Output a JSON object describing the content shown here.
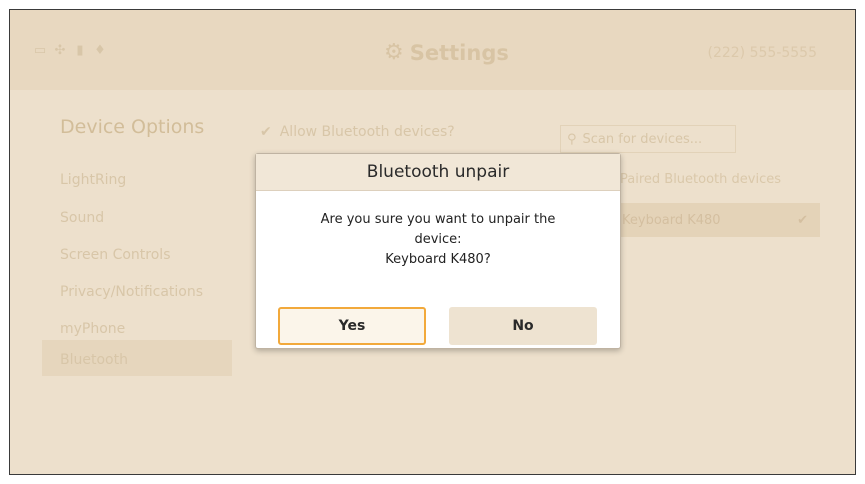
{
  "header": {
    "icons": [
      "display-icon",
      "arrows-icon",
      "camera-icon",
      "microphone-icon"
    ],
    "title": "Settings",
    "phone": "(222) 555-5555"
  },
  "sidebar": {
    "title": "Device Options",
    "items": [
      {
        "label": "LightRing"
      },
      {
        "label": "Sound"
      },
      {
        "label": "Screen Controls"
      },
      {
        "label": "Privacy/Notifications"
      },
      {
        "label": "myPhone"
      },
      {
        "label": "Bluetooth",
        "selected": true
      }
    ]
  },
  "content": {
    "allow_label": "Allow Bluetooth devices?",
    "scan_label": "Scan for devices...",
    "paired_label": "Paired Bluetooth devices",
    "paired_device": "Keyboard K480"
  },
  "dialog": {
    "title": "Bluetooth unpair",
    "message_line1": "Are you sure you want to unpair the",
    "message_line2": "device:",
    "message_line3": "Keyboard K480?",
    "yes_label": "Yes",
    "no_label": "No"
  },
  "colors": {
    "accent": "#f2a93b",
    "background": "#ede0cc"
  }
}
